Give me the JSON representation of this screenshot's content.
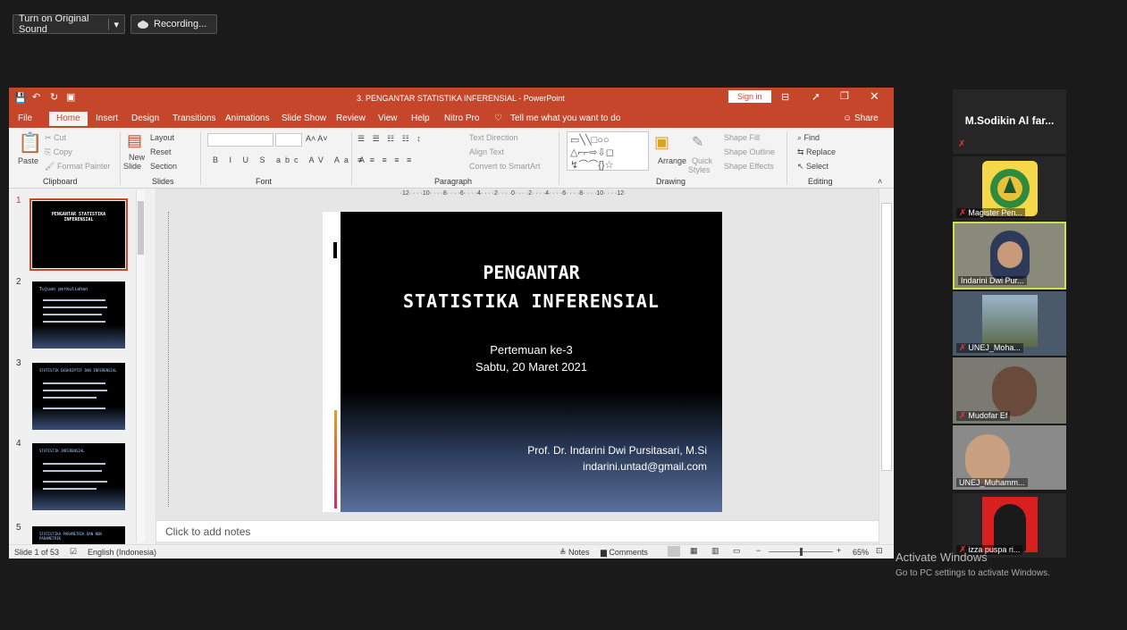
{
  "zoom": {
    "original_sound": "Turn on Original Sound",
    "dropdown": "▾",
    "recording": "Recording...",
    "watermark_title": "Activate Windows",
    "watermark_sub": "Go to PC settings to activate Windows."
  },
  "ppt": {
    "window_title": "3. PENGANTAR STATISTIKA INFERENSIAL - PowerPoint",
    "sign_in": "Sign in",
    "tabs": [
      "File",
      "Home",
      "Insert",
      "Design",
      "Transitions",
      "Animations",
      "Slide Show",
      "Review",
      "View",
      "Help",
      "Nitro Pro"
    ],
    "tell_me": "Tell me what you want to do",
    "share": "Share",
    "ribbon": {
      "clipboard": {
        "label": "Clipboard",
        "paste": "Paste",
        "cut": "Cut",
        "copy": "Copy",
        "format_painter": "Format Painter"
      },
      "slides": {
        "label": "Slides",
        "new_slide": "New",
        "new_slide2": "Slide",
        "layout": "Layout",
        "reset": "Reset",
        "section": "Section"
      },
      "font": {
        "label": "Font"
      },
      "paragraph": {
        "label": "Paragraph",
        "text_direction": "Text Direction",
        "align_text": "Align Text",
        "convert": "Convert to SmartArt"
      },
      "drawing": {
        "label": "Drawing",
        "arrange": "Arrange",
        "quick": "Quick",
        "styles": "Styles",
        "shape_fill": "Shape Fill",
        "shape_outline": "Shape Outline",
        "shape_effects": "Shape Effects"
      },
      "editing": {
        "label": "Editing",
        "find": "Find",
        "replace": "Replace",
        "select": "Select"
      }
    },
    "thumbnails": [
      {
        "num": "1",
        "title": "PENGANTAR STATISTIKA INFERENSIAL"
      },
      {
        "num": "2",
        "title": "Tujuan perkuliahan"
      },
      {
        "num": "3",
        "title": "STATISTIK DESKRIPTIF DAN INFERENSIAL"
      },
      {
        "num": "4",
        "title": "STATISTIK INFERENSIAL"
      },
      {
        "num": "5",
        "title": "STATISTIKA PARAMETRIK DAN NON PARAMETRIK"
      }
    ],
    "ruler": "·12· · · ·10· · · ·8· · · ·6· · · ·4· · · ·2· · · ·0· · · ·2· · · ·4· · · ·6· · · ·8· · · ·10· · · ·12·",
    "slide": {
      "title1": "PENGANTAR",
      "title2": "STATISTIKA INFERENSIAL",
      "line1": "Pertemuan ke-3",
      "line2": "Sabtu, 20 Maret 2021",
      "author": "Prof. Dr. Indarini Dwi Pursitasari, M.Si",
      "email": "indarini.untad@gmail.com"
    },
    "notes_placeholder": "Click to add notes",
    "status": {
      "slide_of": "Slide 1 of 53",
      "language": "English (Indonesia)",
      "notes": "Notes",
      "comments": "Comments",
      "zoom": "65%"
    }
  },
  "participants": [
    {
      "name": "M.Sodikin Al far..."
    },
    {
      "name": "Magister Pen..."
    },
    {
      "name": "Indarini Dwi Pur..."
    },
    {
      "name": "UNEJ_Moha..."
    },
    {
      "name": "Mudofar Ef"
    },
    {
      "name": "UNEJ_Muhamm..."
    },
    {
      "name": "izza puspa ri..."
    }
  ]
}
